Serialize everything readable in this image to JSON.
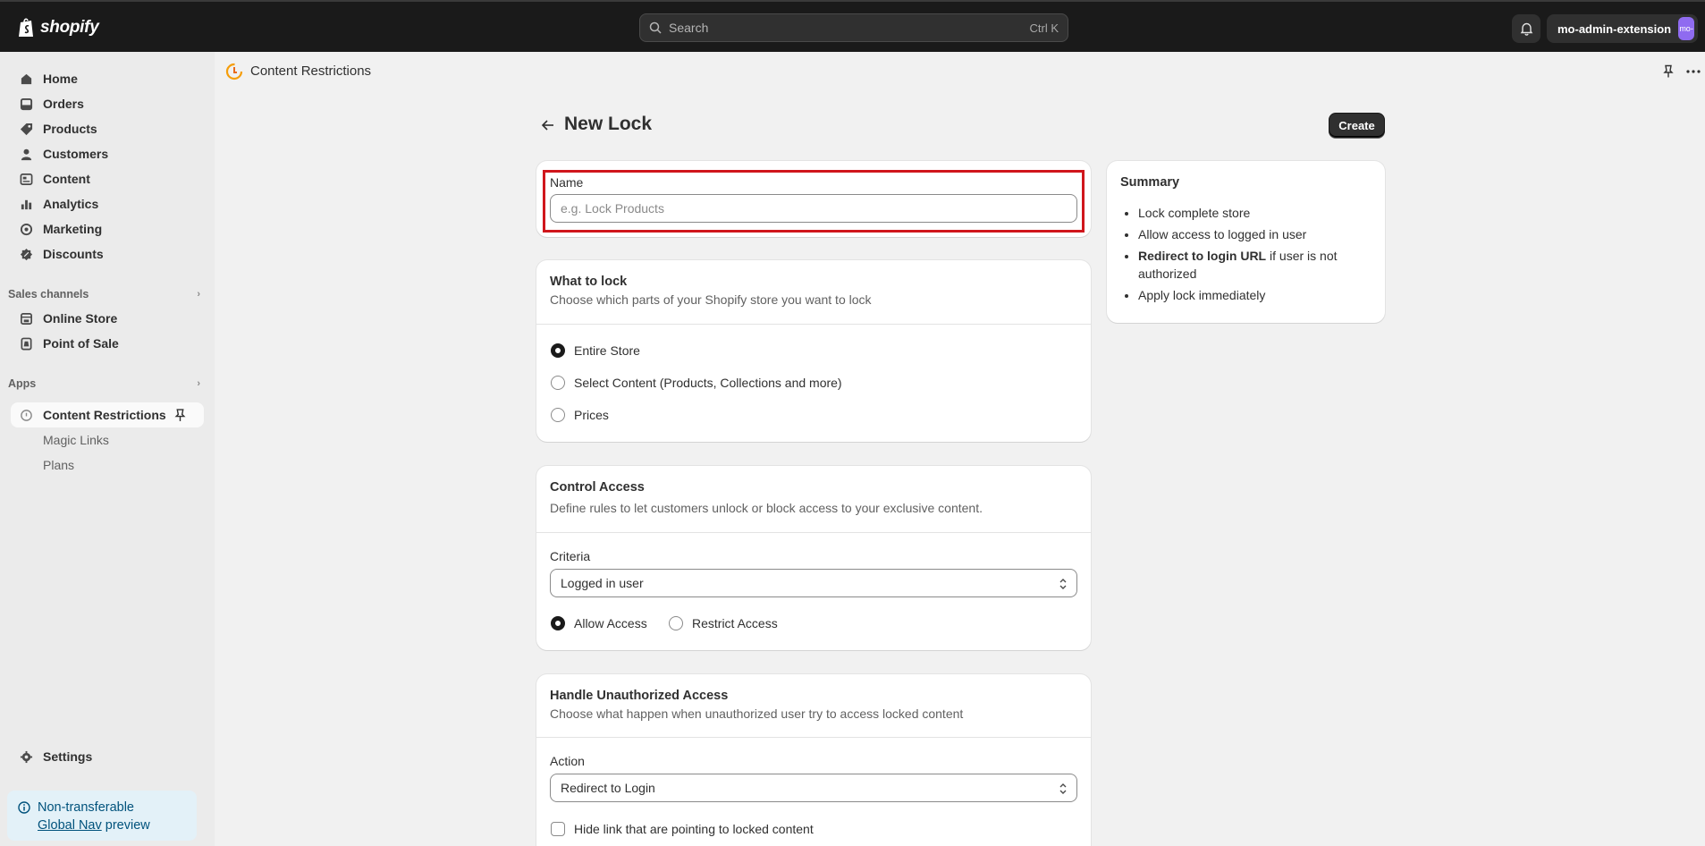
{
  "topbar": {
    "logo_text": "shopify",
    "search_placeholder": "Search",
    "search_shortcut": "Ctrl K",
    "account_name": "mo-admin-extension",
    "account_initials": "mo-"
  },
  "sidebar": {
    "main_items": [
      {
        "label": "Home",
        "icon": "home-icon"
      },
      {
        "label": "Orders",
        "icon": "orders-icon"
      },
      {
        "label": "Products",
        "icon": "tag-icon"
      },
      {
        "label": "Customers",
        "icon": "person-icon"
      },
      {
        "label": "Content",
        "icon": "content-icon"
      },
      {
        "label": "Analytics",
        "icon": "bar-chart-icon"
      },
      {
        "label": "Marketing",
        "icon": "target-icon"
      },
      {
        "label": "Discounts",
        "icon": "discount-icon"
      }
    ],
    "sales_channels_label": "Sales channels",
    "sales_channels": [
      {
        "label": "Online Store",
        "icon": "store-icon"
      },
      {
        "label": "Point of Sale",
        "icon": "pos-icon"
      }
    ],
    "apps_label": "Apps",
    "app_active": "Content Restrictions",
    "app_subitems": [
      "Magic Links",
      "Plans"
    ],
    "settings_label": "Settings",
    "notice": {
      "text_before": "Non-transferable",
      "link": "Global Nav",
      "text_after": "preview"
    }
  },
  "app_header": {
    "title": "Content Restrictions"
  },
  "page": {
    "title": "New Lock",
    "create_label": "Create"
  },
  "name_card": {
    "label": "Name",
    "placeholder": "e.g. Lock Products",
    "value": ""
  },
  "what_to_lock": {
    "title": "What to lock",
    "description": "Choose which parts of your Shopify store you want to lock",
    "options": [
      "Entire Store",
      "Select Content (Products, Collections and more)",
      "Prices"
    ],
    "selected": "Entire Store"
  },
  "control_access": {
    "title": "Control Access",
    "description": "Define rules to let customers unlock or block access to your exclusive content.",
    "criteria_label": "Criteria",
    "criteria_value": "Logged in user",
    "options": [
      "Allow Access",
      "Restrict Access"
    ],
    "selected": "Allow Access"
  },
  "unauthorized": {
    "title": "Handle Unauthorized Access",
    "description": "Choose what happen when unauthorized user try to access locked content",
    "action_label": "Action",
    "action_value": "Redirect to Login",
    "checkbox_label": "Hide link that are pointing to locked content",
    "checkbox_checked": false
  },
  "summary": {
    "title": "Summary",
    "item1": "Lock complete store",
    "item2": "Allow access to logged in user",
    "item3_bold": "Redirect to login URL",
    "item3_rest": "if user is not authorized",
    "item4": "Apply lock immediately"
  }
}
